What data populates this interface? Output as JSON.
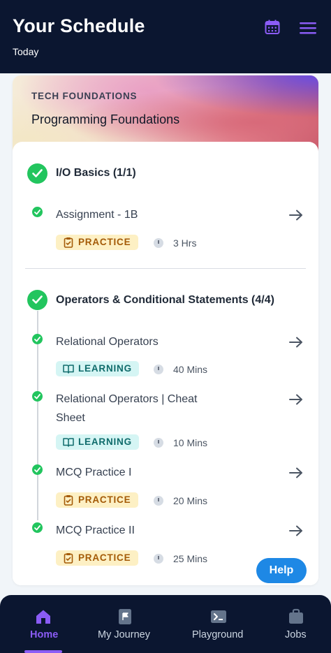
{
  "header": {
    "title": "Your Schedule",
    "subtitle": "Today",
    "calendar_icon": "calendar-icon",
    "menu_icon": "hamburger-menu-icon",
    "accent_color": "#8b5cf6"
  },
  "course": {
    "category": "TECH FOUNDATIONS",
    "name": "Programming Foundations"
  },
  "sections": [
    {
      "title": "I/O Basics (1/1)",
      "items": [
        {
          "title": "Assignment - 1B",
          "tag": "PRACTICE",
          "duration": "3 Hrs"
        }
      ]
    },
    {
      "title": "Operators & Conditional Statements (4/4)",
      "items": [
        {
          "title": "Relational Operators",
          "tag": "LEARNING",
          "duration": "40 Mins"
        },
        {
          "title": "Relational Operators | Cheat Sheet",
          "tag": "LEARNING",
          "duration": "10 Mins"
        },
        {
          "title": "MCQ Practice I",
          "tag": "PRACTICE",
          "duration": "20 Mins"
        },
        {
          "title": "MCQ Practice II",
          "tag": "PRACTICE",
          "duration": "25 Mins"
        }
      ]
    }
  ],
  "help_label": "Help",
  "tabs": [
    {
      "label": "Home",
      "icon": "home-icon",
      "active": true
    },
    {
      "label": "My Journey",
      "icon": "journey-flag-icon",
      "active": false
    },
    {
      "label": "Playground",
      "icon": "terminal-icon",
      "active": false
    },
    {
      "label": "Jobs",
      "icon": "briefcase-icon",
      "active": false
    }
  ],
  "colors": {
    "header_bg": "#0b1630",
    "complete_green": "#22c55e",
    "practice_bg": "#fdf0c4",
    "learning_bg": "#d5f5f4",
    "help_blue": "#1e88e5"
  }
}
